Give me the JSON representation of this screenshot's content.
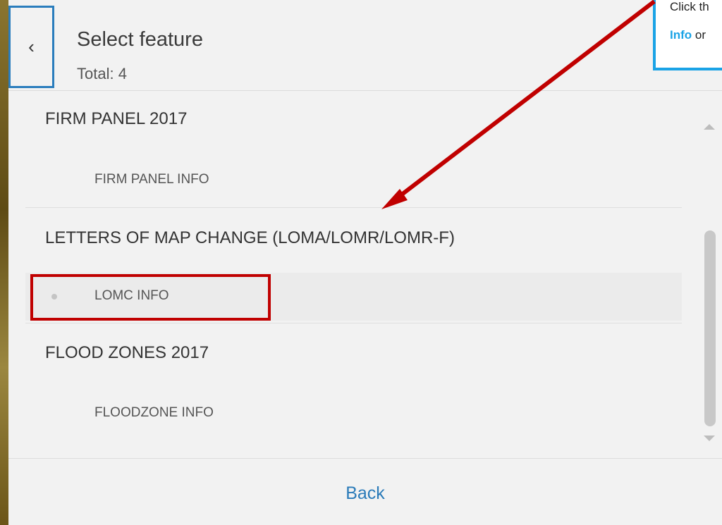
{
  "header": {
    "back_icon": "chevron-left-icon",
    "title": "Select feature",
    "total": "Total: 4"
  },
  "layers": [
    {
      "title": "FIRM PANEL 2017",
      "features": [
        "FIRM PANEL INFO"
      ]
    },
    {
      "title": "LETTERS OF MAP CHANGE (LOMA/LOMR/LOMR-F)",
      "features": [
        "LOMC INFO"
      ]
    },
    {
      "title": "FLOOD ZONES 2017",
      "features": [
        "FLOODZONE INFO"
      ]
    }
  ],
  "footer": {
    "back_label": "Back"
  },
  "callout": {
    "line1": "Click th",
    "line2_bold": "Info",
    "line2_rest": " or"
  },
  "colors": {
    "accent_blue": "#2b7bb9",
    "highlight_red": "#c00000",
    "callout_border": "#1aa3e6",
    "arrow": "#c00000"
  }
}
